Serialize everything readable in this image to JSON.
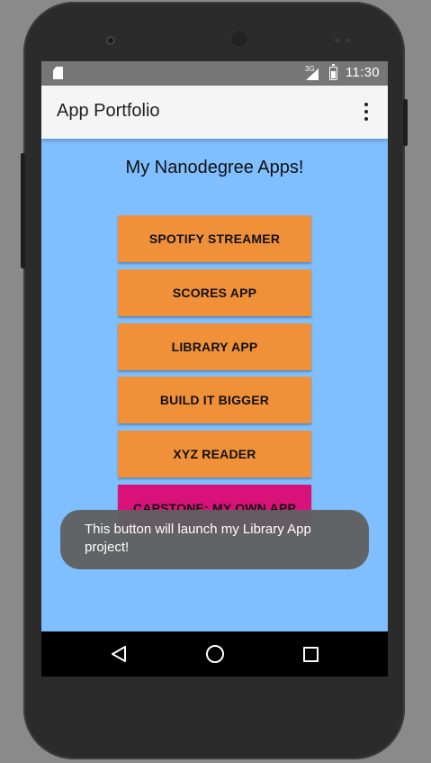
{
  "statusbar": {
    "network_type": "3G",
    "time": "11:30"
  },
  "appbar": {
    "title": "App Portfolio",
    "overflow_icon": "more-vert-icon"
  },
  "main": {
    "heading": "My Nanodegree Apps!",
    "buttons": [
      {
        "label": "SPOTIFY STREAMER",
        "color": "#f0913a"
      },
      {
        "label": "SCORES APP",
        "color": "#f0913a"
      },
      {
        "label": "LIBRARY APP",
        "color": "#f0913a"
      },
      {
        "label": "BUILD IT BIGGER",
        "color": "#f0913a"
      },
      {
        "label": "XYZ READER",
        "color": "#f0913a"
      },
      {
        "label": "CAPSTONE: MY OWN APP",
        "color": "#d9127a"
      }
    ],
    "background_color": "#80bfff"
  },
  "toast": {
    "message": "This button will launch my Library App project!"
  },
  "navbar": {
    "icons": [
      "back-icon",
      "home-icon",
      "recents-icon"
    ]
  }
}
